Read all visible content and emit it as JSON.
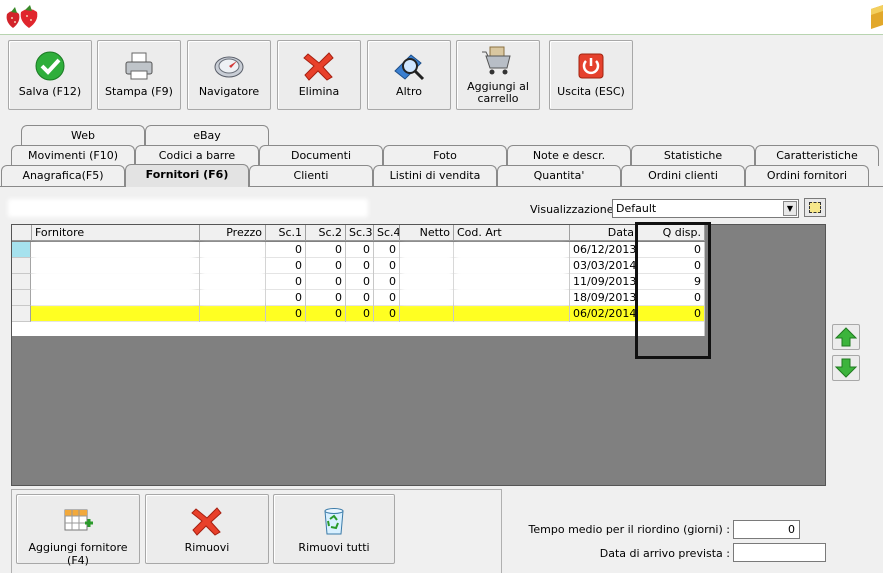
{
  "toolbar": [
    {
      "id": "save",
      "label": "Salva (F12)",
      "icon": "check-icon"
    },
    {
      "id": "print",
      "label": "Stampa (F9)",
      "icon": "printer-icon"
    },
    {
      "id": "navigator",
      "label": "Navigatore",
      "icon": "compass-icon"
    },
    {
      "id": "delete",
      "label": "Elimina",
      "icon": "red-x-icon"
    },
    {
      "id": "other",
      "label": "Altro",
      "icon": "magnifier-icon"
    },
    {
      "id": "cart",
      "label": "Aggiungi al carrello",
      "icon": "cart-icon"
    },
    {
      "id": "exit",
      "label": "Uscita (ESC)",
      "icon": "power-icon"
    }
  ],
  "tabs": {
    "row1": [
      "Web",
      "eBay"
    ],
    "row2": [
      "Movimenti (F10)",
      "Codici a barre",
      "Documenti",
      "Foto",
      "Note e descr.",
      "Statistiche",
      "Caratteristiche"
    ],
    "row3": [
      "Anagrafica(F5)",
      "Fornitori (F6)",
      "Clienti",
      "Listini di vendita",
      "Quantita'",
      "Ordini clienti",
      "Ordini fornitori"
    ],
    "active": "Fornitori (F6)"
  },
  "view": {
    "label": "Visualizzazione :",
    "value": "Default"
  },
  "grid": {
    "columns": [
      "Fornitore",
      "Prezzo",
      "Sc.1",
      "Sc.2",
      "Sc.3",
      "Sc.4",
      "Netto",
      "Cod. Art",
      "Data",
      "Q disp."
    ],
    "rows": [
      {
        "fornitore": "",
        "prezzo": "",
        "sc1": "0",
        "sc2": "0",
        "sc3": "0",
        "sc4": "0",
        "netto": "",
        "codart": "",
        "data": "06/12/2013",
        "qdisp": "0"
      },
      {
        "fornitore": "",
        "prezzo": "",
        "sc1": "0",
        "sc2": "0",
        "sc3": "0",
        "sc4": "0",
        "netto": "",
        "codart": "",
        "data": "03/03/2014",
        "qdisp": "0"
      },
      {
        "fornitore": "",
        "prezzo": "",
        "sc1": "0",
        "sc2": "0",
        "sc3": "0",
        "sc4": "0",
        "netto": "",
        "codart": "",
        "data": "11/09/2013",
        "qdisp": "9"
      },
      {
        "fornitore": "",
        "prezzo": "",
        "sc1": "0",
        "sc2": "0",
        "sc3": "0",
        "sc4": "0",
        "netto": "",
        "codart": "",
        "data": "18/09/2013",
        "qdisp": "0"
      },
      {
        "fornitore": "",
        "prezzo": "",
        "sc1": "0",
        "sc2": "0",
        "sc3": "0",
        "sc4": "0",
        "netto": "",
        "codart": "",
        "data": "06/02/2014",
        "qdisp": "0"
      }
    ],
    "selected_row": 4
  },
  "bottom_buttons": [
    {
      "id": "add-supplier",
      "label": "Aggiungi fornitore (F4)",
      "icon": "grid-plus-icon"
    },
    {
      "id": "remove",
      "label": "Rimuovi",
      "icon": "red-x-icon"
    },
    {
      "id": "remove-all",
      "label": "Rimuovi tutti",
      "icon": "recycle-bin-icon"
    }
  ],
  "form": {
    "reorder_label": "Tempo medio per il riordino (giorni) :",
    "reorder_value": "0",
    "arrival_label": "Data di arrivo prevista :",
    "arrival_value": ""
  }
}
